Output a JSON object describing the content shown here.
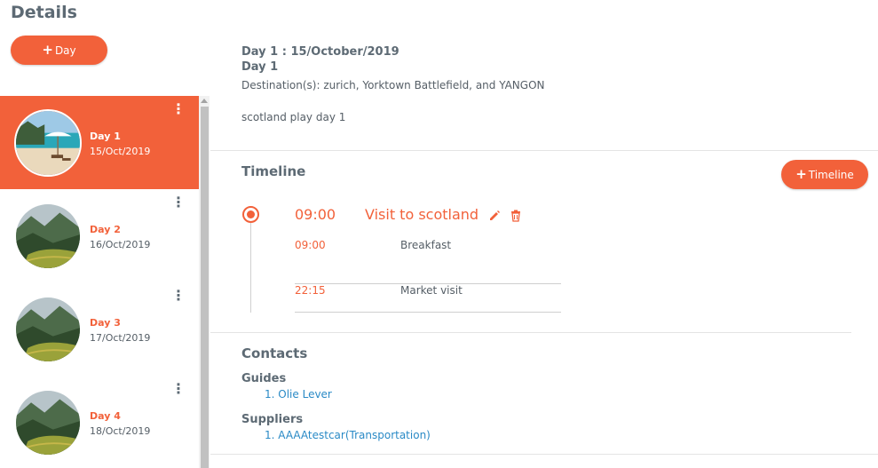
{
  "page": {
    "title": "Details"
  },
  "add_day": {
    "icon": "plus-icon",
    "label": "Day"
  },
  "days": [
    {
      "label": "Day 1",
      "date": "15/Oct/2019",
      "active": true,
      "image": "beach"
    },
    {
      "label": "Day 2",
      "date": "16/Oct/2019",
      "active": false,
      "image": "mountain"
    },
    {
      "label": "Day 3",
      "date": "17/Oct/2019",
      "active": false,
      "image": "mountain"
    },
    {
      "label": "Day 4",
      "date": "18/Oct/2019",
      "active": false,
      "image": "mountain"
    }
  ],
  "day_detail": {
    "heading": "Day 1 : 15/October/2019",
    "subheading": "Day 1",
    "destinations": "Destination(s): zurich, Yorktown Battlefield, and YANGON",
    "notes": "scotland play day 1"
  },
  "timeline": {
    "title": "Timeline",
    "add_label": "Timeline",
    "event": {
      "time": "09:00",
      "title": "Visit to scotland"
    },
    "activities": [
      {
        "time": "09:00",
        "name": "Breakfast"
      },
      {
        "time": "22:15",
        "name": "Market visit"
      }
    ]
  },
  "contacts": {
    "title": "Contacts",
    "guides_label": "Guides",
    "guides": [
      {
        "num": "1.",
        "name": "Olie Lever"
      }
    ],
    "suppliers_label": "Suppliers",
    "suppliers": [
      {
        "num": "1.",
        "name": "AAAAtestcar(Transportation)"
      }
    ]
  },
  "colors": {
    "accent": "#f2613a",
    "link": "#2a8ac6",
    "text": "#555e66"
  }
}
